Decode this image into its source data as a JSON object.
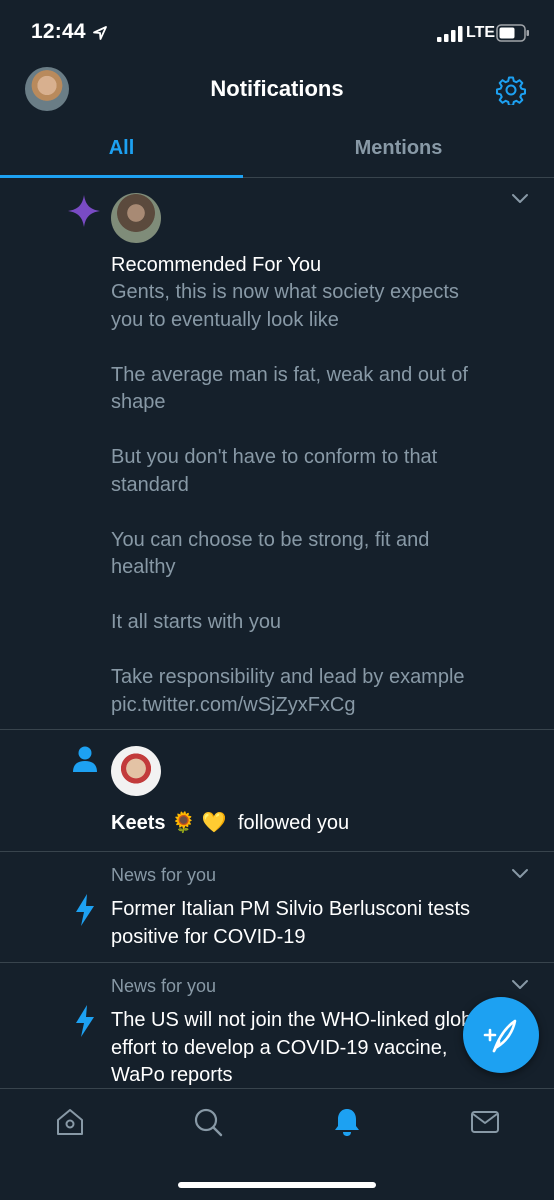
{
  "status_bar": {
    "time": "12:44",
    "network": "LTE"
  },
  "header": {
    "title": "Notifications"
  },
  "tabs": [
    {
      "label": "All",
      "active": true
    },
    {
      "label": "Mentions",
      "active": false
    }
  ],
  "notifications": [
    {
      "type": "recommended",
      "icon": "sparkle-icon",
      "heading": "Recommended For You",
      "lines": [
        "Gents, this is now what society expects",
        "you to eventually look like",
        "",
        "The average man is fat, weak and out of",
        "shape",
        "",
        "But you don't have to conform to that",
        "standard",
        "",
        "You can choose to be strong, fit and",
        "healthy",
        "",
        "It all starts with you",
        "",
        "Take responsibility and lead by example",
        "pic.twitter.com/wSjZyxFxCg"
      ]
    },
    {
      "type": "follow",
      "icon": "person-icon",
      "user": "Keets",
      "emoji": "🌻 💛",
      "action": "followed you"
    },
    {
      "type": "news",
      "icon": "lightning-icon",
      "label": "News for you",
      "lines": [
        "Former Italian PM Silvio Berlusconi tests",
        "positive for COVID-19"
      ]
    },
    {
      "type": "news",
      "icon": "lightning-icon",
      "label": "News for you",
      "lines": [
        "The US will not join the WHO-linked global",
        "effort to develop a COVID-19 vaccine,",
        "WaPo reports"
      ]
    }
  ],
  "colors": {
    "accent": "#1da1f2",
    "background": "#15202b",
    "muted": "#8899a6",
    "sparkle": "#794bc4"
  },
  "nav": [
    "home-icon",
    "search-icon",
    "bell-icon",
    "mail-icon"
  ]
}
